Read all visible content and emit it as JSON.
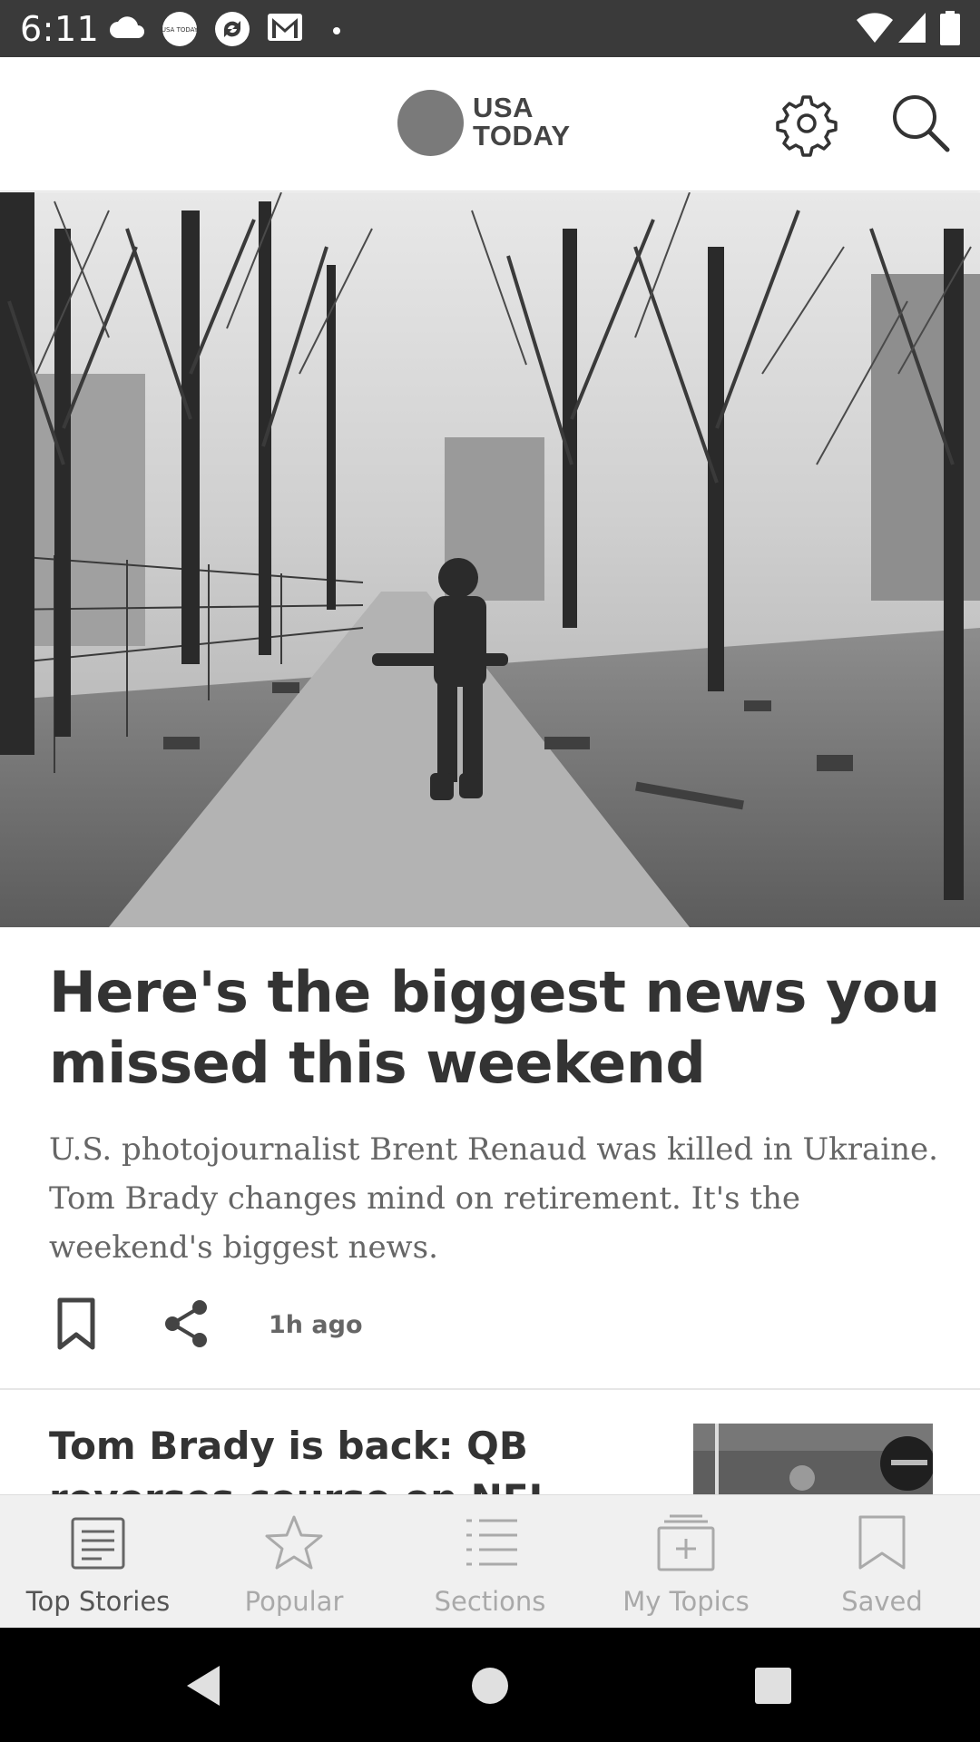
{
  "status_bar": {
    "time": "6:11",
    "icons": [
      "cloud-icon",
      "usa-today-notification-icon",
      "sync-icon",
      "gmail-icon",
      "dot-icon",
      "wifi-icon",
      "signal-icon",
      "battery-icon"
    ],
    "notification_badge_text": "USA TODAY"
  },
  "header": {
    "logo_line1": "USA",
    "logo_line2": "TODAY",
    "icons": [
      "gear-icon",
      "search-icon"
    ]
  },
  "hero": {
    "image_subject": "soldier-walking-on-road-photo"
  },
  "article": {
    "headline": "Here's the biggest news you missed this weekend",
    "summary": "U.S. photojournalist Brent Renaud was killed in Ukraine. Tom Brady changes mind on retirement. It's the weekend's biggest news.",
    "time_ago": "1h ago"
  },
  "next_story": {
    "title": "Tom Brady is back: QB reverses course on NFL"
  },
  "tabs": [
    {
      "label": "Top Stories",
      "icon": "newspaper-icon",
      "active": true
    },
    {
      "label": "Popular",
      "icon": "star-icon",
      "active": false
    },
    {
      "label": "Sections",
      "icon": "list-icon",
      "active": false
    },
    {
      "label": "My Topics",
      "icon": "add-topic-icon",
      "active": false
    },
    {
      "label": "Saved",
      "icon": "bookmark-icon",
      "active": false
    }
  ],
  "colors": {
    "status_bar_bg": "#3a3a3a",
    "active_tab": "#555555",
    "inactive_tab": "#a9a9a9",
    "headline": "#333333",
    "summary": "#666666"
  }
}
